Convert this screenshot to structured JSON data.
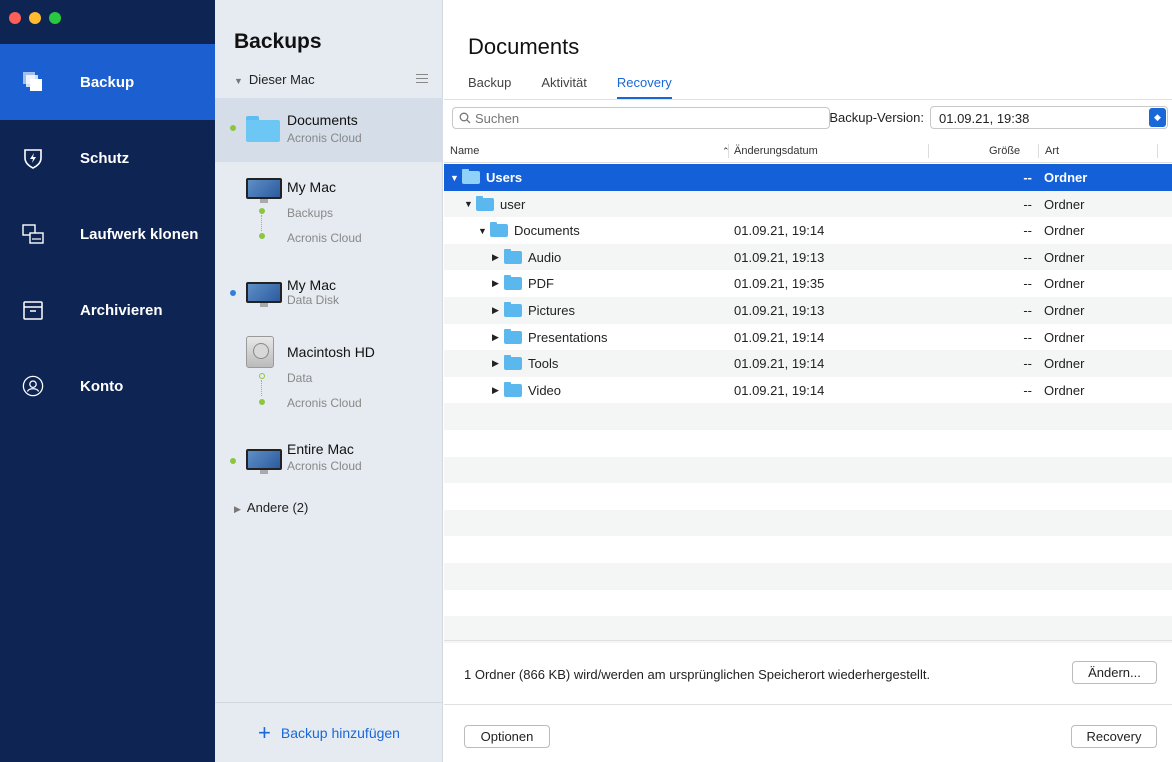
{
  "nav": {
    "items": [
      {
        "label": "Backup",
        "icon": "backup-icon",
        "active": true
      },
      {
        "label": "Schutz",
        "icon": "shield-icon",
        "active": false
      },
      {
        "label": "Laufwerk klonen",
        "icon": "clone-disk-icon",
        "active": false
      },
      {
        "label": "Archivieren",
        "icon": "archive-icon",
        "active": false
      },
      {
        "label": "Konto",
        "icon": "account-icon",
        "active": false
      }
    ],
    "accent": "#1c5fd0",
    "background": "#0e2453"
  },
  "sources": {
    "title": "Backups",
    "group": "Dieser Mac",
    "items": [
      {
        "name": "Documents",
        "sub": "Acronis Cloud"
      },
      {
        "name": "My Mac",
        "sub1": "Backups",
        "sub2": "Acronis Cloud"
      },
      {
        "name": "My Mac",
        "sub": "Data Disk"
      },
      {
        "name": "Macintosh HD",
        "sub1": "Data",
        "sub2": "Acronis Cloud"
      },
      {
        "name": "Entire Mac",
        "sub": "Acronis Cloud"
      }
    ],
    "other": "Andere (2)",
    "add_label": "Backup hinzufügen"
  },
  "main": {
    "title": "Documents",
    "tabs": [
      "Backup",
      "Aktivität",
      "Recovery"
    ],
    "active_tab": "Recovery",
    "search_placeholder": "Suchen",
    "version_label": "Backup-Version:",
    "version_value": "01.09.21, 19:38",
    "columns": {
      "name": "Name",
      "date": "Änderungsdatum",
      "size": "Größe",
      "type": "Art"
    },
    "rows": [
      {
        "name": "Users",
        "level": 0,
        "disc": "▼",
        "date": "",
        "size": "--",
        "type": "Ordner",
        "selected": true
      },
      {
        "name": "user",
        "level": 1,
        "disc": "▼",
        "date": "",
        "size": "--",
        "type": "Ordner"
      },
      {
        "name": "Documents",
        "level": 2,
        "disc": "▼",
        "date": "01.09.21, 19:14",
        "size": "--",
        "type": "Ordner"
      },
      {
        "name": "Audio",
        "level": 3,
        "disc": "▶",
        "date": "01.09.21, 19:13",
        "size": "--",
        "type": "Ordner"
      },
      {
        "name": "PDF",
        "level": 3,
        "disc": "▶",
        "date": "01.09.21, 19:35",
        "size": "--",
        "type": "Ordner"
      },
      {
        "name": "Pictures",
        "level": 3,
        "disc": "▶",
        "date": "01.09.21, 19:13",
        "size": "--",
        "type": "Ordner"
      },
      {
        "name": "Presentations",
        "level": 3,
        "disc": "▶",
        "date": "01.09.21, 19:14",
        "size": "--",
        "type": "Ordner"
      },
      {
        "name": "Tools",
        "level": 3,
        "disc": "▶",
        "date": "01.09.21, 19:14",
        "size": "--",
        "type": "Ordner"
      },
      {
        "name": "Video",
        "level": 3,
        "disc": "▶",
        "date": "01.09.21, 19:14",
        "size": "--",
        "type": "Ordner"
      }
    ],
    "status_text": "1 Ordner (866 KB) wird/werden am ursprünglichen Speicherort wiederhergestellt.",
    "change_button": "Ändern...",
    "options_button": "Optionen",
    "recovery_button": "Recovery"
  }
}
